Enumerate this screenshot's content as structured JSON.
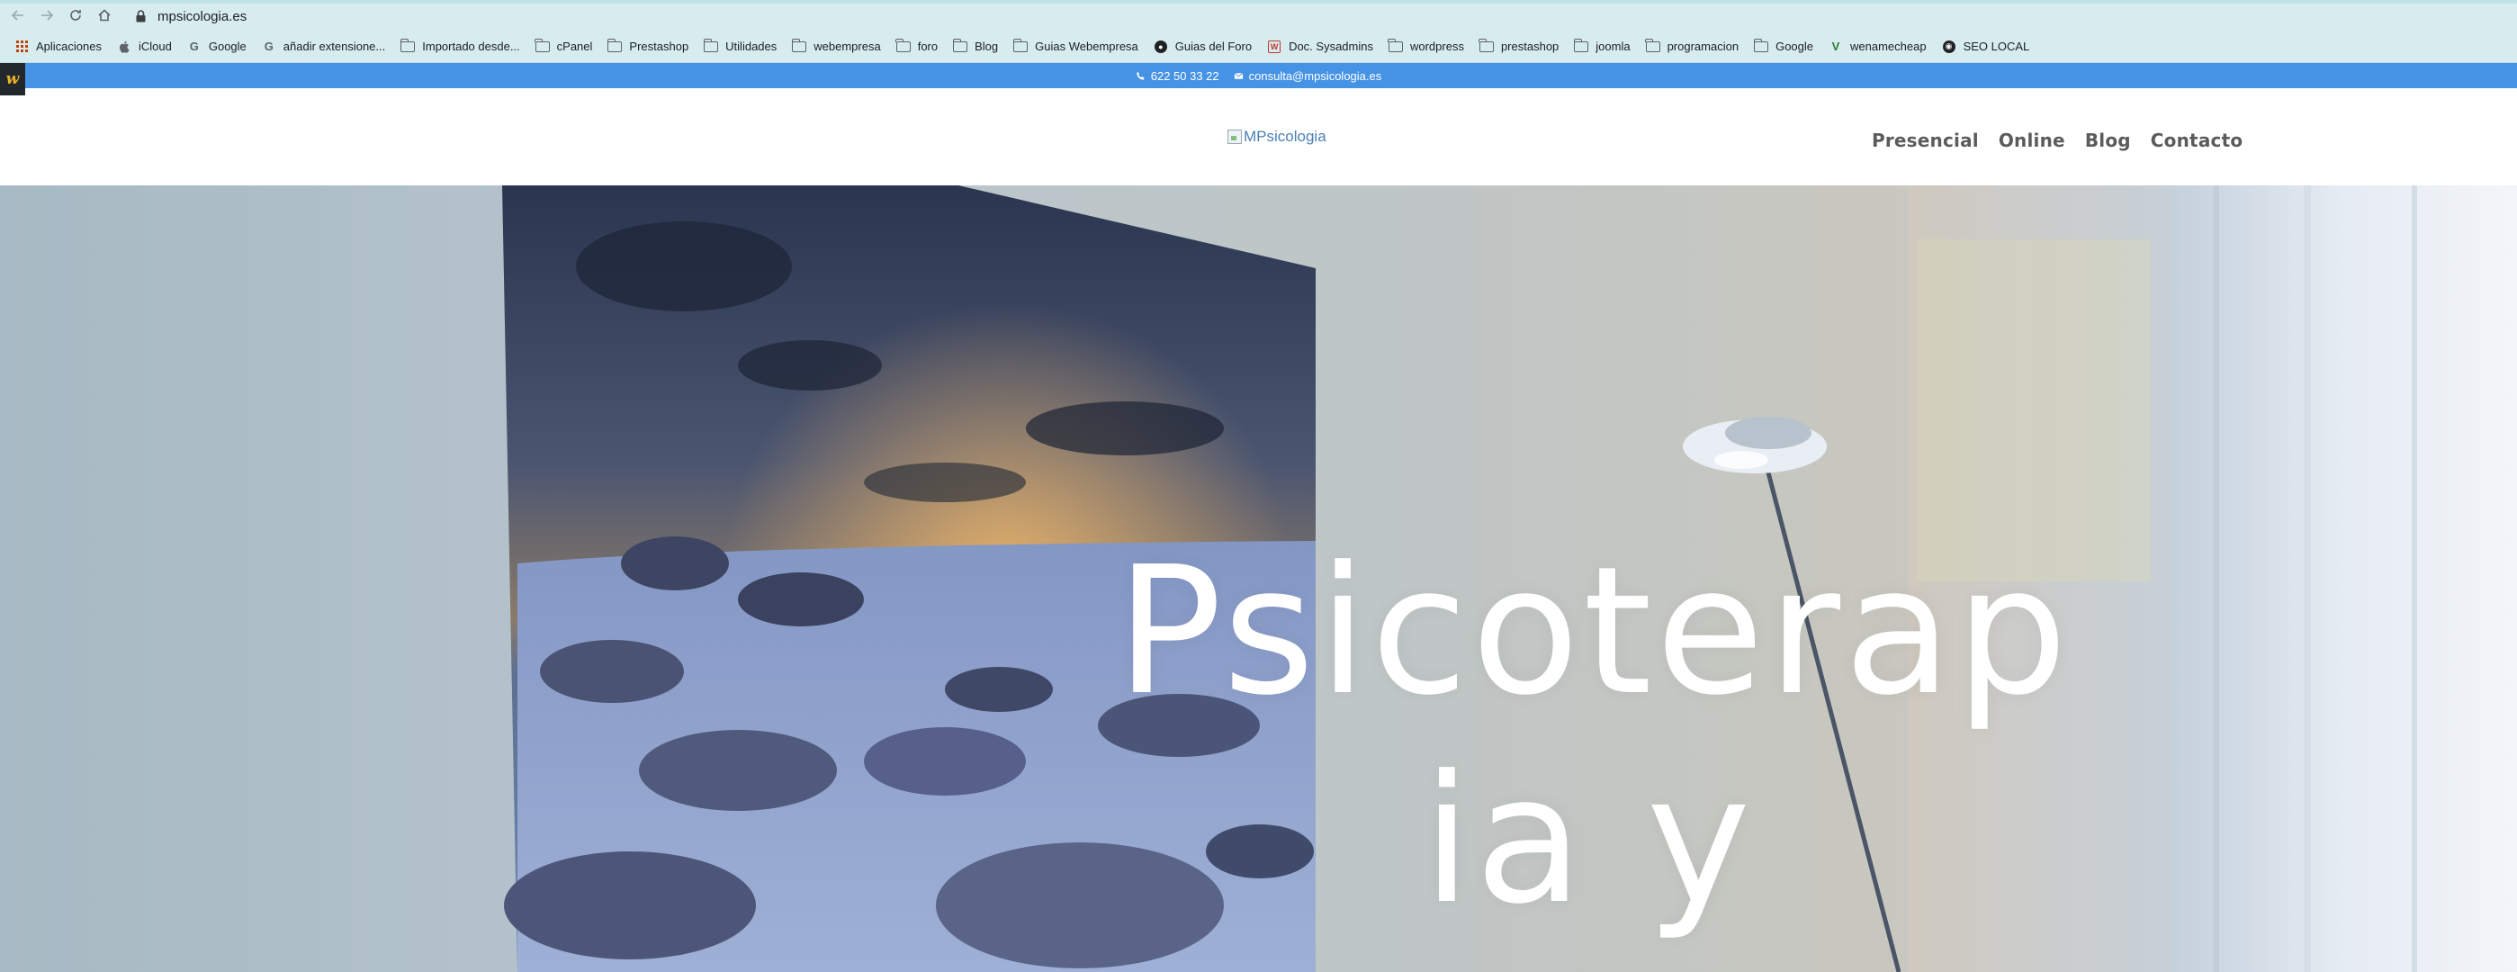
{
  "browser": {
    "url": "mpsicologia.es",
    "bookmarks": [
      {
        "label": "Aplicaciones",
        "icon": "apps-grid-icon"
      },
      {
        "label": "iCloud",
        "icon": "apple-icon"
      },
      {
        "label": "Google",
        "icon": "google-icon"
      },
      {
        "label": "añadir extensione...",
        "icon": "google-icon"
      },
      {
        "label": "Importado desde...",
        "icon": "folder-icon"
      },
      {
        "label": "cPanel",
        "icon": "folder-icon"
      },
      {
        "label": "Prestashop",
        "icon": "folder-icon"
      },
      {
        "label": "Utilidades",
        "icon": "folder-icon"
      },
      {
        "label": "webempresa",
        "icon": "folder-icon"
      },
      {
        "label": "foro",
        "icon": "folder-icon"
      },
      {
        "label": "Blog",
        "icon": "folder-icon"
      },
      {
        "label": "Guias Webempresa",
        "icon": "folder-icon"
      },
      {
        "label": "Guias del Foro",
        "icon": "site-round-icon"
      },
      {
        "label": "Doc. Sysadmins",
        "icon": "site-w-icon"
      },
      {
        "label": "wordpress",
        "icon": "folder-icon"
      },
      {
        "label": "prestashop",
        "icon": "folder-icon"
      },
      {
        "label": "joomla",
        "icon": "folder-icon"
      },
      {
        "label": "programacion",
        "icon": "folder-icon"
      },
      {
        "label": "Google",
        "icon": "folder-icon"
      },
      {
        "label": "wenamecheap",
        "icon": "site-v-icon"
      },
      {
        "label": "SEO LOCAL",
        "icon": "site-globe-icon"
      }
    ]
  },
  "site": {
    "wp_badge": "w",
    "topbar": {
      "phone": "622 50 33 22",
      "email": "consulta@mpsicologia.es"
    },
    "logo_alt": "MPsicologia",
    "nav": [
      "Presencial",
      "Online",
      "Blog",
      "Contacto"
    ],
    "hero": {
      "line1": "Psicoterap",
      "line2": "ia y"
    }
  },
  "colors": {
    "chrome": "#d6ecef",
    "topbar": "#4693e6",
    "nav_text": "#5b5b5b",
    "hero_text": "#ffffff"
  }
}
